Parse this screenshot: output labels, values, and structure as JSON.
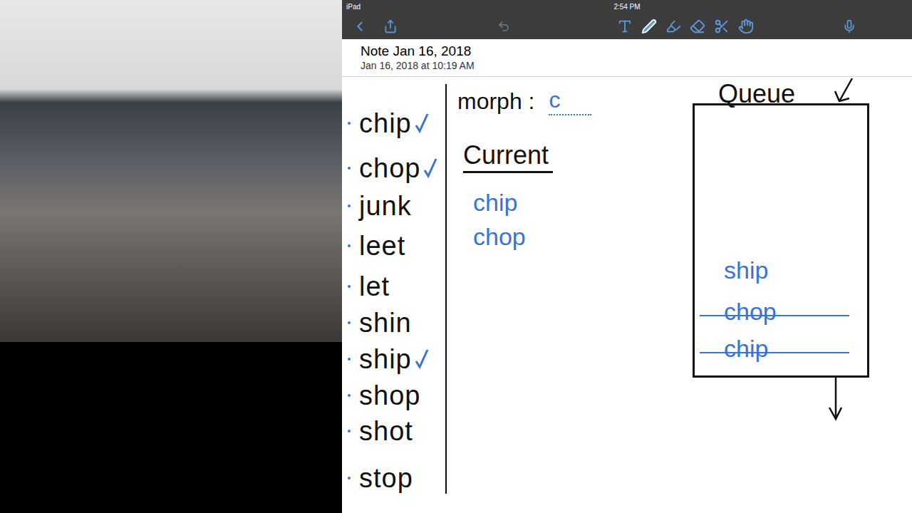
{
  "device_status": {
    "device": "iPad",
    "time": "2:54 PM"
  },
  "note": {
    "title": "Note Jan 16, 2018",
    "date": "Jan 16, 2018 at 10:19 AM"
  },
  "words": [
    {
      "text": "chip",
      "checked": true
    },
    {
      "text": "chop",
      "checked": true
    },
    {
      "text": "junk",
      "checked": false
    },
    {
      "text": "leet",
      "checked": false
    },
    {
      "text": "let",
      "checked": false
    },
    {
      "text": "shin",
      "checked": false
    },
    {
      "text": "ship",
      "checked": true
    },
    {
      "text": "shop",
      "checked": false
    },
    {
      "text": "shot",
      "checked": false
    },
    {
      "text": "stop",
      "checked": false
    }
  ],
  "morph": {
    "label": "morph :",
    "value": "c"
  },
  "current": {
    "heading": "Current",
    "items": [
      "chip",
      "chop"
    ]
  },
  "queue": {
    "heading": "Queue",
    "items": [
      {
        "text": "ship",
        "removed": false
      },
      {
        "text": "chop",
        "removed": true
      },
      {
        "text": "chip",
        "removed": true
      }
    ]
  }
}
